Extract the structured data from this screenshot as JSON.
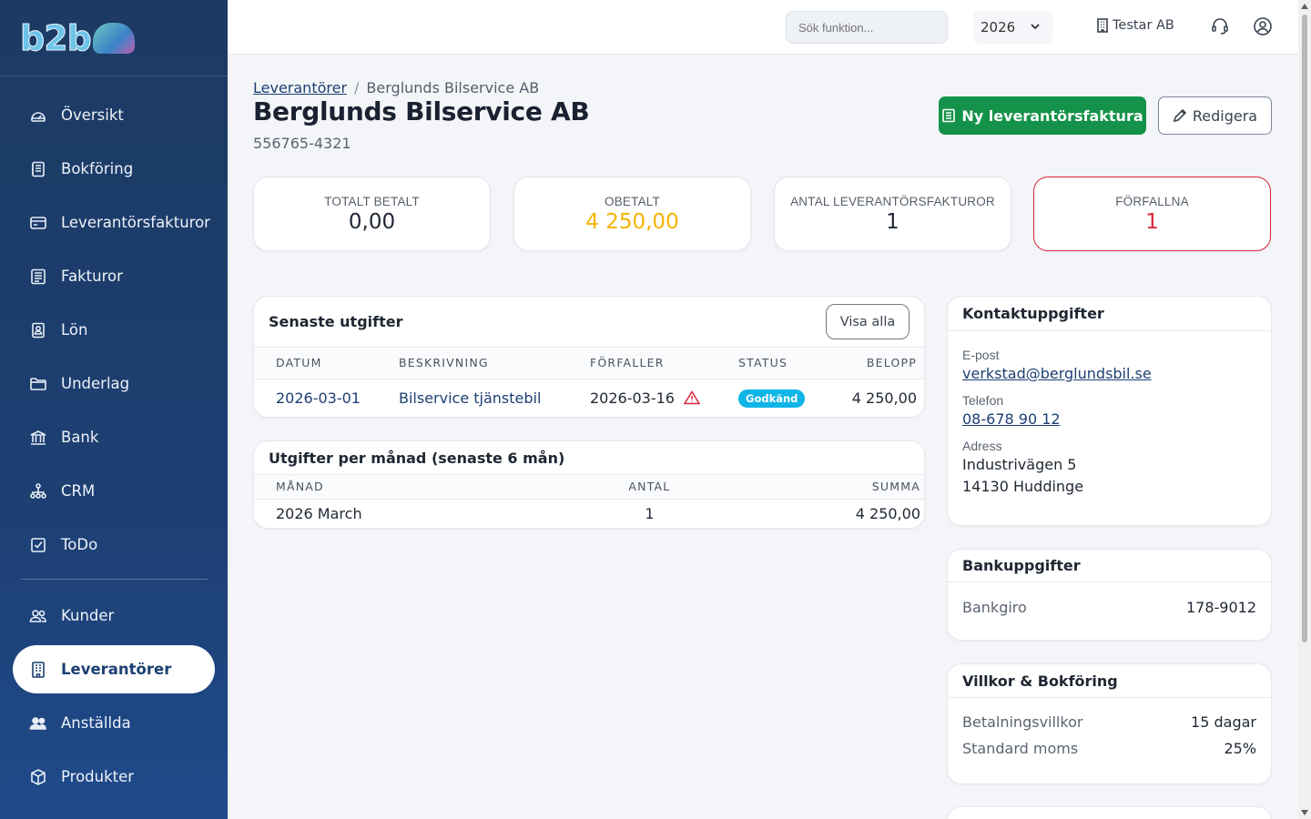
{
  "sidebar": {
    "logo": "b2b",
    "items": [
      {
        "label": "Översikt",
        "icon": "gauge-icon"
      },
      {
        "label": "Bokföring",
        "icon": "ledger-icon"
      },
      {
        "label": "Leverantörsfakturor",
        "icon": "card-icon"
      },
      {
        "label": "Fakturor",
        "icon": "invoice-icon"
      },
      {
        "label": "Lön",
        "icon": "badge-icon"
      },
      {
        "label": "Underlag",
        "icon": "folder-icon"
      },
      {
        "label": "Bank",
        "icon": "bank-icon"
      },
      {
        "label": "CRM",
        "icon": "network-icon"
      },
      {
        "label": "ToDo",
        "icon": "checkbox-icon"
      }
    ],
    "items2": [
      {
        "label": "Kunder",
        "icon": "users-icon"
      },
      {
        "label": "Leverantörer",
        "icon": "building-icon",
        "active": true
      },
      {
        "label": "Anställda",
        "icon": "people-icon"
      },
      {
        "label": "Produkter",
        "icon": "box-icon"
      }
    ]
  },
  "topbar": {
    "search_placeholder": "Sök funktion...",
    "year": "2026",
    "company": "Testar AB"
  },
  "breadcrumb": {
    "parent": "Leverantörer",
    "current": "Berglunds Bilservice AB"
  },
  "supplier": {
    "name": "Berglunds Bilservice AB",
    "orgnr": "556765-4321"
  },
  "actions": {
    "new_invoice": "Ny leverantörsfaktura",
    "edit": "Redigera"
  },
  "stats": {
    "total_paid_label": "TOTALT BETALT",
    "total_paid": "0,00",
    "unpaid_label": "OBETALT",
    "unpaid": "4 250,00",
    "count_label": "ANTAL LEVERANTÖRSFAKTUROR",
    "count": "1",
    "overdue_label": "FÖRFALLNA",
    "overdue": "1",
    "accent_warn": "#f4b400",
    "accent_danger": "#d7263d"
  },
  "recent": {
    "title": "Senaste utgifter",
    "view_all": "Visa alla",
    "columns": [
      "DATUM",
      "BESKRIVNING",
      "FÖRFALLER",
      "STATUS",
      "BELOPP"
    ],
    "rows": [
      {
        "date": "2026-03-01",
        "desc": "Bilservice tjänstebil",
        "due": "2026-03-16",
        "status": "Godkänd",
        "amount": "4 250,00"
      }
    ]
  },
  "monthly": {
    "title": "Utgifter per månad (senaste 6 mån)",
    "columns": [
      "MÅNAD",
      "ANTAL",
      "SUMMA"
    ],
    "rows": [
      {
        "month": "2026 March",
        "count": "1",
        "sum": "4 250,00"
      }
    ]
  },
  "contact": {
    "title": "Kontaktuppgifter",
    "email_label": "E-post",
    "email": "verkstad@berglundsbil.se",
    "phone_label": "Telefon",
    "phone": "08-678 90 12",
    "address_label": "Adress",
    "address_line1": "Industrivägen 5",
    "address_line2": "14130 Huddinge"
  },
  "bank": {
    "title": "Bankuppgifter",
    "bankgiro_label": "Bankgiro",
    "bankgiro": "178-9012"
  },
  "terms": {
    "title": "Villkor & Bokföring",
    "payment_label": "Betalningsvillkor",
    "payment": "15 dagar",
    "vat_label": "Standard moms",
    "vat": "25%"
  }
}
